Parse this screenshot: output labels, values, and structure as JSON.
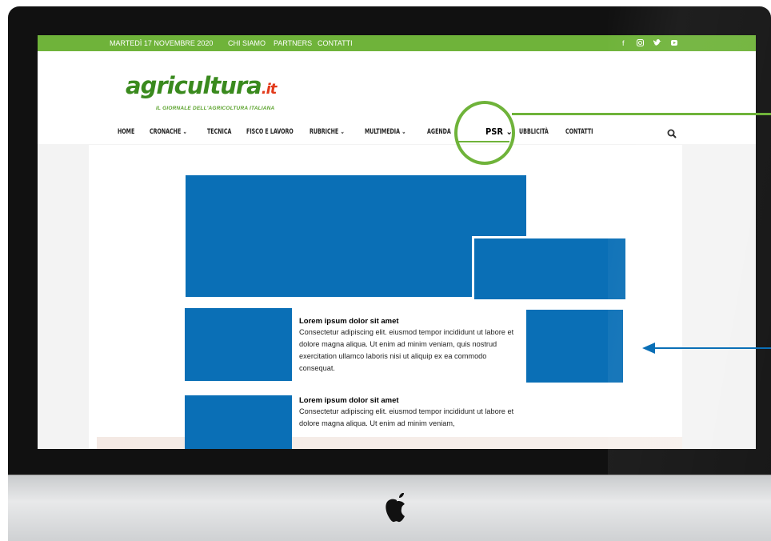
{
  "topbar": {
    "date": "MARTEDÌ 17 NOVEMBRE 2020",
    "links": [
      "CHI SIAMO",
      "PARTNERS",
      "CONTATTI"
    ],
    "social_icons": [
      "facebook-icon",
      "instagram-icon",
      "twitter-icon",
      "youtube-icon"
    ]
  },
  "logo": {
    "name": "agricultura",
    "suffix": ".it",
    "tagline": "IL GIORNALE DELL'AGRICOLTURA ITALIANA"
  },
  "nav": {
    "items": [
      {
        "label": "HOME",
        "dropdown": false
      },
      {
        "label": "CRONACHE ⌄",
        "dropdown": true
      },
      {
        "label": "TECNICA",
        "dropdown": false
      },
      {
        "label": "FISCO E LAVORO",
        "dropdown": false
      },
      {
        "label": "RUBRICHE ⌄",
        "dropdown": true
      },
      {
        "label": "MULTIMEDIA ⌄",
        "dropdown": true
      },
      {
        "label": "AGENDA",
        "dropdown": false
      },
      {
        "label": "PSR ⌄",
        "dropdown": true,
        "active": true
      },
      {
        "label": "UBBLICITÀ",
        "dropdown": false
      },
      {
        "label": "CONTATTI",
        "dropdown": false
      }
    ],
    "search_icon": "search-icon"
  },
  "articles": [
    {
      "title": "Lorem ipsum dolor sit amet",
      "body": "Consectetur adipiscing elit. eiusmod tempor incididunt ut labore et dolore magna aliqua. Ut enim ad minim veniam, quis nostrud exercitation ullamco laboris nisi ut aliquip ex ea commodo consequat."
    },
    {
      "title": "Lorem ipsum dolor sit amet",
      "body": "Consectetur adipiscing elit. eiusmod tempor incididunt ut labore et dolore magna aliqua. Ut enim ad minim veniam,"
    }
  ],
  "colors": {
    "brand_green": "#6fb33a",
    "placeholder_blue": "#0a6fb6",
    "logo_red": "#e23a1b"
  }
}
